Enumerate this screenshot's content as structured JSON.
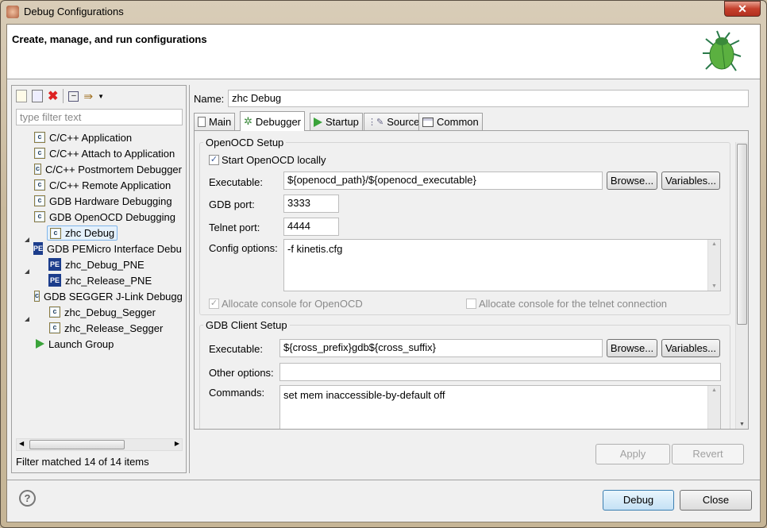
{
  "window": {
    "title": "Debug Configurations",
    "close": "✕"
  },
  "header": {
    "title": "Create, manage, and run configurations"
  },
  "sidebar": {
    "filter_placeholder": "type filter text",
    "items": [
      {
        "label": "C/C++ Application",
        "icon": "c-config-icon"
      },
      {
        "label": "C/C++ Attach to Application",
        "icon": "c-config-icon"
      },
      {
        "label": "C/C++ Postmortem Debugger",
        "icon": "c-config-icon"
      },
      {
        "label": "C/C++ Remote Application",
        "icon": "c-config-icon"
      },
      {
        "label": "GDB Hardware Debugging",
        "icon": "c-config-icon"
      },
      {
        "label": "GDB OpenOCD Debugging",
        "icon": "c-config-icon"
      },
      {
        "label": "zhc Debug",
        "icon": "c-config-icon"
      },
      {
        "label": "GDB PEMicro Interface Debugging",
        "icon": "pe-icon"
      },
      {
        "label": "zhc_Debug_PNE",
        "icon": "pe-icon"
      },
      {
        "label": "zhc_Release_PNE",
        "icon": "pe-icon"
      },
      {
        "label": "GDB SEGGER J-Link Debugging",
        "icon": "c-config-icon"
      },
      {
        "label": "zhc_Debug_Segger",
        "icon": "c-config-icon"
      },
      {
        "label": "zhc_Release_Segger",
        "icon": "c-config-icon"
      },
      {
        "label": "Launch Group",
        "icon": "play-icon"
      }
    ],
    "status": "Filter matched 14 of 14 items"
  },
  "main": {
    "name_label": "Name:",
    "name_value": "zhc Debug",
    "tabs": [
      {
        "label": "Main"
      },
      {
        "label": "Debugger"
      },
      {
        "label": "Startup"
      },
      {
        "label": "Source"
      },
      {
        "label": "Common"
      }
    ],
    "openocd": {
      "title": "OpenOCD Setup",
      "start_locally": "Start OpenOCD locally",
      "exe_label": "Executable:",
      "exe_value": "${openocd_path}/${openocd_executable}",
      "gdb_port_label": "GDB port:",
      "gdb_port": "3333",
      "telnet_label": "Telnet port:",
      "telnet_port": "4444",
      "config_label": "Config options:",
      "config_value": "-f kinetis.cfg",
      "alloc_console": "Allocate console for OpenOCD",
      "alloc_telnet": "Allocate console for the telnet connection"
    },
    "gdb": {
      "title": "GDB Client Setup",
      "exe_label": "Executable:",
      "exe_value": "${cross_prefix}gdb${cross_suffix}",
      "other_label": "Other options:",
      "other_value": "",
      "commands_label": "Commands:",
      "commands_value": "set mem inaccessible-by-default off"
    },
    "browse": "Browse...",
    "variables": "Variables...",
    "apply": "Apply",
    "revert": "Revert"
  },
  "footer": {
    "debug": "Debug",
    "close": "Close",
    "help": "?"
  }
}
